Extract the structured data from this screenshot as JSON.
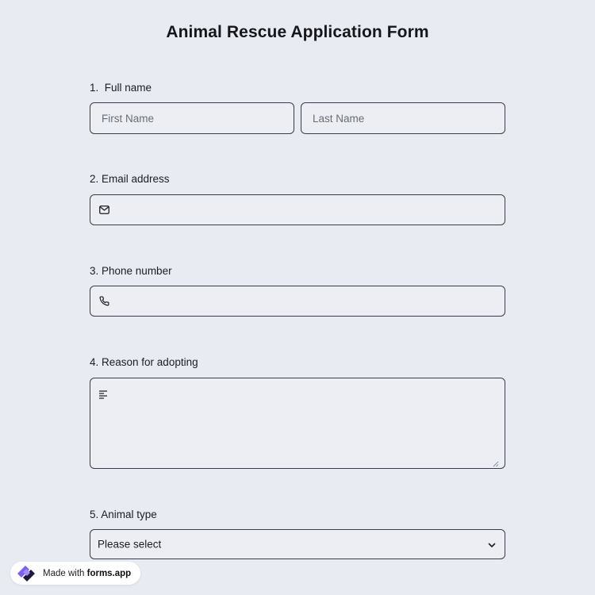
{
  "form": {
    "title": "Animal Rescue Application Form",
    "questions": [
      {
        "label": "1.  Full name",
        "first_placeholder": "First Name",
        "last_placeholder": "Last Name"
      },
      {
        "label": "2. Email address",
        "icon": "mail-icon"
      },
      {
        "label": "3. Phone number",
        "icon": "phone-icon"
      },
      {
        "label": "4. Reason for adopting",
        "icon": "text-lines-icon"
      },
      {
        "label": "5. Animal type",
        "selected": "Please select",
        "icon": "chevron-down-icon"
      }
    ]
  },
  "badge": {
    "prefix": "Made with ",
    "brand": "forms.app"
  },
  "colors": {
    "background": "#e9ebf2",
    "field_border": "#3a3d47",
    "logo_purple": "#7b5cf5",
    "logo_dark": "#1e1b3a"
  }
}
